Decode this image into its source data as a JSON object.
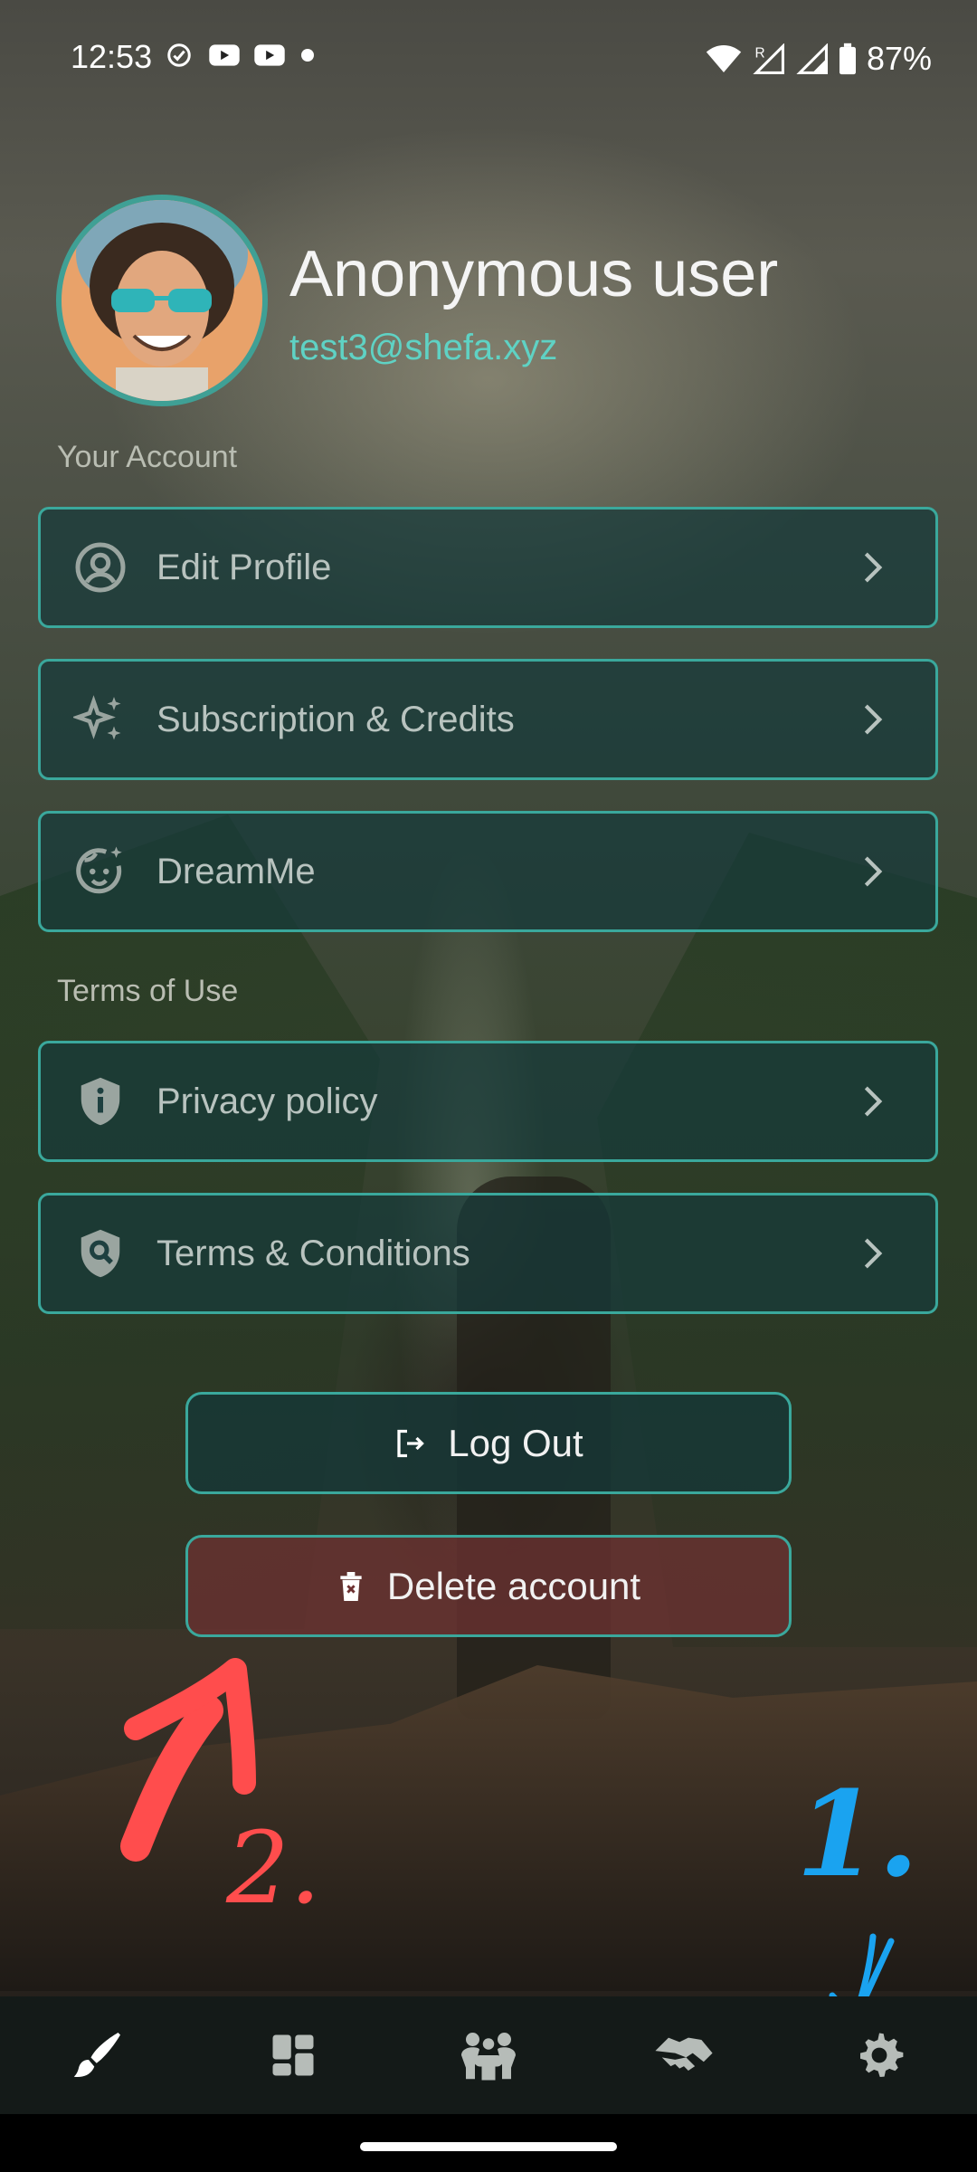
{
  "status_bar": {
    "time": "12:53",
    "battery": "87%",
    "left_icons": [
      "check-circle-icon",
      "youtube-icon",
      "youtube-icon",
      "dot-icon"
    ],
    "right_icons": [
      "wifi-icon",
      "signal-roaming-icon",
      "signal-icon",
      "battery-icon"
    ]
  },
  "profile": {
    "name": "Anonymous user",
    "email": "test3@shefa.xyz"
  },
  "sections": {
    "account_label": "Your Account",
    "terms_label": "Terms of Use"
  },
  "account_items": [
    {
      "label": "Edit Profile",
      "icon": "user-circle-icon"
    },
    {
      "label": "Subscription & Credits",
      "icon": "sparkles-icon"
    },
    {
      "label": "DreamMe",
      "icon": "face-sparkle-icon"
    }
  ],
  "terms_items": [
    {
      "label": "Privacy policy",
      "icon": "shield-info-icon"
    },
    {
      "label": "Terms & Conditions",
      "icon": "shield-search-icon"
    }
  ],
  "buttons": {
    "logout": "Log Out",
    "delete": "Delete account"
  },
  "annotations": {
    "step1": "1.",
    "step2": "2."
  },
  "bottom_nav": [
    {
      "icon": "brush-icon"
    },
    {
      "icon": "dashboard-icon"
    },
    {
      "icon": "community-icon"
    },
    {
      "icon": "handshake-icon"
    },
    {
      "icon": "settings-gear-icon",
      "active": true
    }
  ],
  "colors": {
    "accent": "#3aa89c",
    "email": "#5fd2c4",
    "annotation_red": "#ff4d4d",
    "annotation_blue": "#1aa3f0"
  }
}
